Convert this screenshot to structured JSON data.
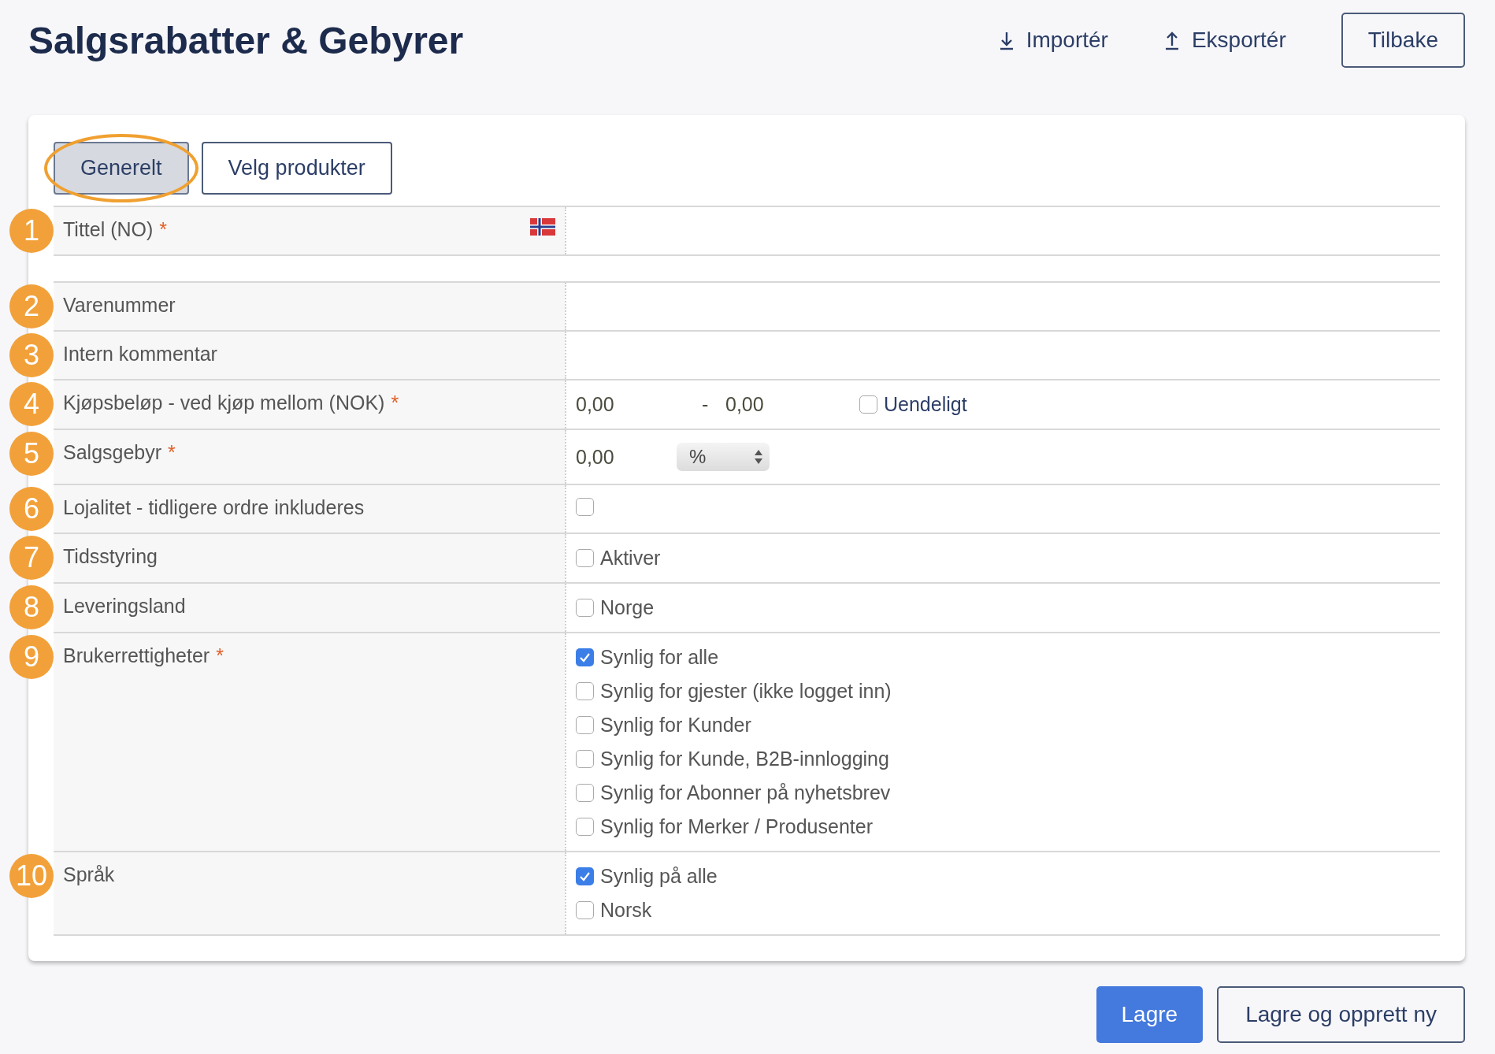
{
  "header": {
    "title": "Salgsrabatter & Gebyrer",
    "actions": [
      {
        "label": "Importér",
        "kind": "import"
      },
      {
        "label": "Eksportér",
        "kind": "export"
      }
    ],
    "back": "Tilbake"
  },
  "tabs": [
    {
      "label": "Generelt",
      "selected": true,
      "highlighted": true
    },
    {
      "label": "Velg produkter",
      "selected": false,
      "highlighted": false
    }
  ],
  "rows": [
    {
      "marker": "1",
      "label": "Tittel (NO)",
      "required_mark": "*",
      "kind": "title"
    },
    {
      "marker": "2",
      "label": "Varenummer",
      "kind": "text"
    },
    {
      "marker": "3",
      "label": "Intern kommentar",
      "kind": "text"
    },
    {
      "marker": "4",
      "label": "Kjøpsbeløp - ved kjøp mellom (NOK)",
      "required_mark": "*",
      "kind": "range",
      "from": "0,00",
      "separator": "-",
      "to": "0,00",
      "option": {
        "label": "Uendeligt",
        "checked": false
      }
    },
    {
      "marker": "5",
      "label": "Salgsgebyr",
      "required_mark": "*",
      "kind": "fee",
      "value": "0,00",
      "unit": "%"
    },
    {
      "marker": "6",
      "label": "Lojalitet - tidligere ordre inkluderes",
      "kind": "checks",
      "options": [
        {
          "checked": false
        }
      ]
    },
    {
      "marker": "7",
      "label": "Tidsstyring",
      "kind": "checks",
      "options": [
        {
          "label": "Aktiver",
          "checked": false
        }
      ]
    },
    {
      "marker": "8",
      "label": "Leveringsland",
      "kind": "checks",
      "options": [
        {
          "label": "Norge",
          "checked": false
        }
      ]
    },
    {
      "marker": "9",
      "label": "Brukerrettigheter",
      "required_mark": "*",
      "kind": "checks",
      "options": [
        {
          "label": "Synlig for alle",
          "checked": true
        },
        {
          "label": "Synlig for gjester (ikke logget inn)",
          "checked": false
        },
        {
          "label": "Synlig for Kunder",
          "checked": false
        },
        {
          "label": "Synlig for Kunde, B2B-innlogging",
          "checked": false
        },
        {
          "label": "Synlig for Abonner på nyhetsbrev",
          "checked": false
        },
        {
          "label": "Synlig for Merker / Produsenter",
          "checked": false
        }
      ]
    },
    {
      "marker": "10",
      "label": "Språk",
      "kind": "checks",
      "options": [
        {
          "label": "Synlig på alle",
          "checked": true
        },
        {
          "label": "Norsk",
          "checked": false
        }
      ]
    }
  ],
  "footer": {
    "save": "Lagre",
    "save_new": "Lagre og opprett ny"
  }
}
